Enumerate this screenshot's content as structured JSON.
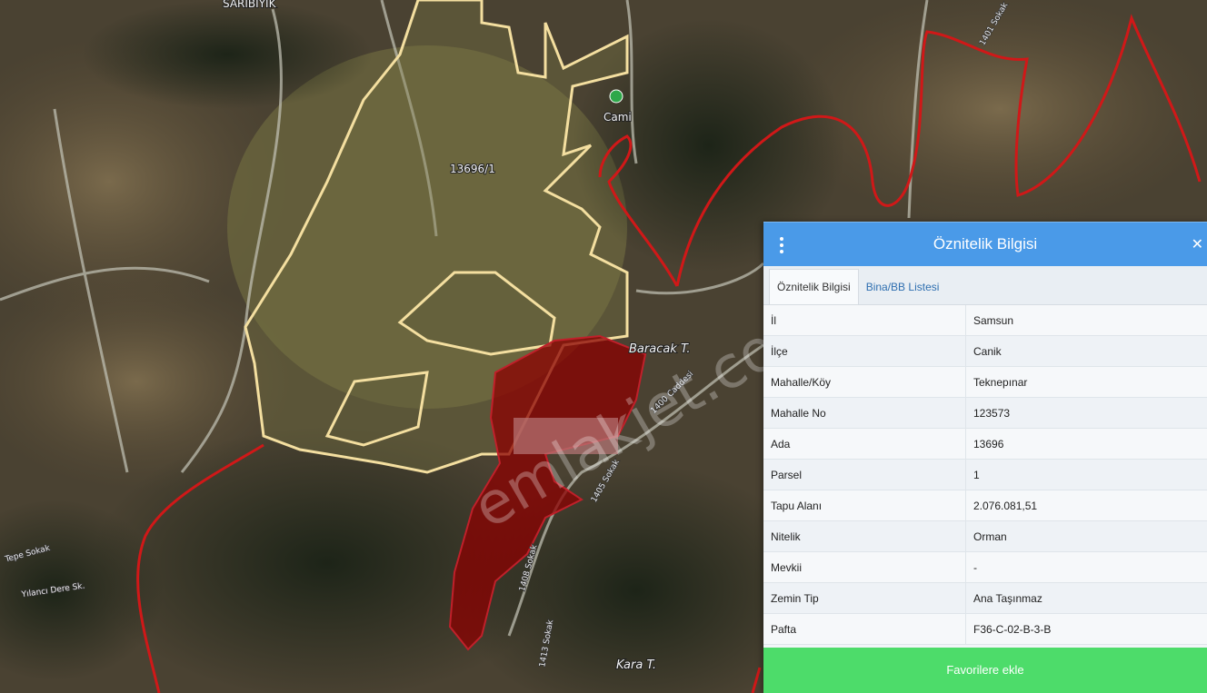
{
  "map": {
    "place_labels": {
      "saribiyik": "SARIBIYIK",
      "cami": "Cami",
      "baracak": "Baracak T.",
      "kara": "Kara T."
    },
    "parcel_label": "13696/1",
    "road_labels": {
      "r1": "1401 Sokak",
      "r2": "1400 Caddesi",
      "r3": "1408 Sokak",
      "r4": "1405 Sokak",
      "r5": "1413 Sokak",
      "r6": "Tepe Sokak",
      "r7": "Yılancı Dere Sk."
    },
    "watermark": "emlakjet.com",
    "colors": {
      "parcel_outline": "#f4dfa0",
      "highlight_fill": "#8b0000",
      "boundary": "#d01818"
    }
  },
  "panel": {
    "title": "Öznitelik Bilgisi",
    "menu_icon": "kebab-menu-icon",
    "close_icon": "close-icon",
    "tabs": [
      "Öznitelik Bilgisi",
      "Bina/BB Listesi"
    ],
    "rows": [
      {
        "key": "İl",
        "value": "Samsun"
      },
      {
        "key": "İlçe",
        "value": "Canik"
      },
      {
        "key": "Mahalle/Köy",
        "value": "Teknepınar"
      },
      {
        "key": "Mahalle No",
        "value": "123573"
      },
      {
        "key": "Ada",
        "value": "13696"
      },
      {
        "key": "Parsel",
        "value": "1"
      },
      {
        "key": "Tapu Alanı",
        "value": "2.076.081,51"
      },
      {
        "key": "Nitelik",
        "value": "Orman"
      },
      {
        "key": "Mevkii",
        "value": "-"
      },
      {
        "key": "Zemin Tip",
        "value": "Ana Taşınmaz"
      },
      {
        "key": "Pafta",
        "value": "F36-C-02-B-3-B"
      }
    ],
    "favorite_button": "Favorilere ekle",
    "colors": {
      "header": "#4a9ae8",
      "button": "#4ddc6a"
    }
  }
}
